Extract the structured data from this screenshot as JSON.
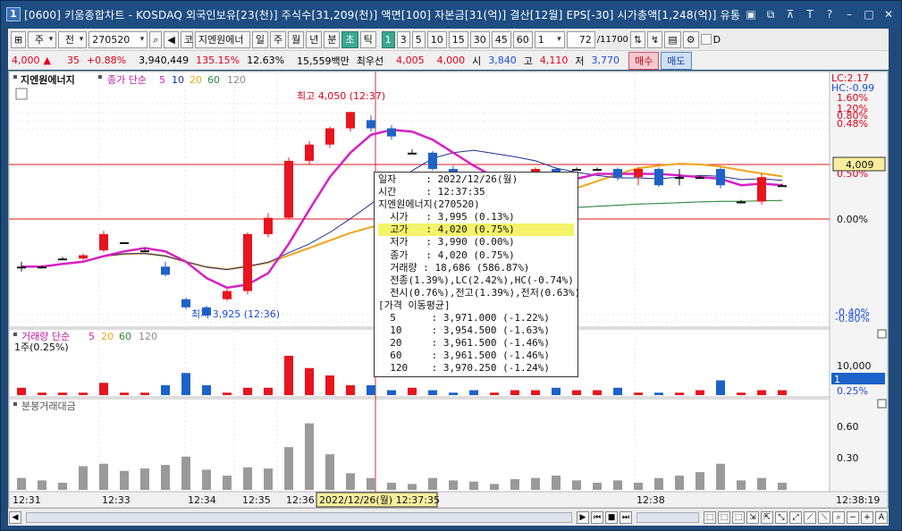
{
  "window": {
    "title": "[0600] 키움종합차트 - KOSDAQ 외국인보유[23(천)] 주식수[31,209(천)] 액면[100] 자본금[31(억)] 결산[12월] EPS[-30] 시가총액[1,248(억)] 유통"
  },
  "toolbar": {
    "period_select": "주",
    "compare_select": "전",
    "code": "270520",
    "stock_name": "지엔원에너",
    "code_prefix": "코",
    "period_buttons": [
      "일",
      "주",
      "월",
      "년",
      "분",
      "초",
      "틱"
    ],
    "interval_buttons": [
      "1",
      "3",
      "5",
      "10",
      "15",
      "30",
      "45",
      "60"
    ],
    "count_value": "1",
    "range_value": "72",
    "range_total": "/11700",
    "d_checkbox_label": "D"
  },
  "quote": {
    "price": "4,000",
    "change_arrow": "▲",
    "change": "35",
    "change_pct": "+0.88%",
    "volume": "3,940,449",
    "volume_ratio": "135.15%",
    "turnover": "12.63%",
    "amount": "15,559백만",
    "best_label": "최우선",
    "ask": "4,005",
    "bid": "4,000",
    "open_label": "시",
    "open": "3,840",
    "high_label": "고",
    "high": "4,110",
    "low_label": "저",
    "low": "3,770",
    "buy_label": "매수",
    "sell_label": "매도"
  },
  "chart": {
    "stock_label": "지엔원에너지",
    "ma_legend": "종가 단순",
    "ma_periods": [
      "5",
      "10",
      "20",
      "60",
      "120"
    ],
    "lc_label": "LC:2.17",
    "hc_label": "HC:-0.99",
    "current_price_tag": "4,009",
    "max_label": "최고 4,050 (12:37)",
    "min_label": "최저 3,925 (12:36)",
    "right_axis": [
      "1.60%",
      "1.20%",
      "0.80%",
      "0.48%",
      "0.50%",
      "0.00%",
      "-0.40%",
      "-0.80%"
    ],
    "volume_legend": "거래량 단순",
    "volume_ma_periods": [
      "5",
      "20",
      "60",
      "120"
    ],
    "volume_unit": "1주(0.25%)",
    "volume_axis": [
      "10,000",
      "1",
      "0.25%"
    ],
    "minute_legend": "분봉거래대금",
    "minute_axis": [
      "0.60",
      "0.30"
    ],
    "time_ticks": [
      "12:31",
      "12:33",
      "12:34",
      "12:35",
      "12:36",
      "12:38"
    ],
    "cursor_time": "2022/12/26(월) 12:37:35",
    "last_time": "12:38:19",
    "colors": {
      "up": "#e8141e",
      "down": "#1c62c8",
      "ma5": "#d620c4",
      "ma10": "#1d2e8f",
      "ma20": "#f0a418",
      "ma60": "#2a8a3a",
      "ma120": "#9a9a9a"
    }
  },
  "tooltip": {
    "rows": [
      "일자     : 2022/12/26(월)",
      "시간     : 12:37:35",
      "지엔원에너지(270520)",
      "  시가   : 3,995 (0.13%)",
      "  고가   : 4,020 (0.75%)",
      "  저가   : 3,990 (0.00%)",
      "  종가   : 4,020 (0.75%)",
      "  거래량 : 18,686 (586.87%)",
      "  전종(1.39%),LC(2.42%),HC(-0.74%)",
      "  전시(0.76%),전고(1.39%),전저(0.63%)",
      "[가격 이동평균]",
      "  5      : 3,971.000 (-1.22%)",
      "  10     : 3,954.500 (-1.63%)",
      "  20     : 3,961.500 (-1.46%)",
      "  60     : 3,961.500 (-1.46%)",
      "  120    : 3,970.250 (-1.24%)"
    ],
    "highlight_index": 4
  },
  "chart_data": {
    "type": "candlestick",
    "candles": [
      {
        "o": 3955,
        "c": 3955,
        "h": 3958,
        "l": 3952
      },
      {
        "o": 3955,
        "c": 3955,
        "h": 3956,
        "l": 3954
      },
      {
        "o": 3960,
        "c": 3960,
        "h": 3961,
        "l": 3959
      },
      {
        "o": 3960,
        "c": 3962,
        "h": 3963,
        "l": 3959
      },
      {
        "o": 3965,
        "c": 3975,
        "h": 3977,
        "l": 3964
      },
      {
        "o": 3970,
        "c": 3970,
        "h": 3970,
        "l": 3970
      },
      {
        "o": 3965,
        "c": 3965,
        "h": 3966,
        "l": 3964
      },
      {
        "o": 3955,
        "c": 3950,
        "h": 3958,
        "l": 3949
      },
      {
        "o": 3935,
        "c": 3930,
        "h": 3936,
        "l": 3929
      },
      {
        "o": 3930,
        "c": 3925,
        "h": 3931,
        "l": 3925
      },
      {
        "o": 3935,
        "c": 3940,
        "h": 3941,
        "l": 3934
      },
      {
        "o": 3940,
        "c": 3975,
        "h": 3976,
        "l": 3938
      },
      {
        "o": 3975,
        "c": 3985,
        "h": 3988,
        "l": 3973
      },
      {
        "o": 3985,
        "c": 4020,
        "h": 4022,
        "l": 3984
      },
      {
        "o": 4020,
        "c": 4030,
        "h": 4032,
        "l": 4018
      },
      {
        "o": 4030,
        "c": 4040,
        "h": 4041,
        "l": 4028
      },
      {
        "o": 4040,
        "c": 4050,
        "h": 4050,
        "l": 4038
      },
      {
        "o": 4045,
        "c": 4040,
        "h": 4048,
        "l": 4038
      },
      {
        "o": 4040,
        "c": 4035,
        "h": 4042,
        "l": 4033
      },
      {
        "o": 4025,
        "c": 4025,
        "h": 4027,
        "l": 4024
      },
      {
        "o": 4025,
        "c": 4015,
        "h": 4026,
        "l": 4014
      },
      {
        "o": 4015,
        "c": 4010,
        "h": 4017,
        "l": 4009
      },
      {
        "o": 4005,
        "c": 4000,
        "h": 4010,
        "l": 3998
      },
      {
        "o": 4000,
        "c": 4000,
        "h": 4002,
        "l": 3998
      },
      {
        "o": 4005,
        "c": 4010,
        "h": 4012,
        "l": 4003
      },
      {
        "o": 4010,
        "c": 4015,
        "h": 4016,
        "l": 4008
      },
      {
        "o": 4015,
        "c": 4005,
        "h": 4016,
        "l": 4003
      },
      {
        "o": 4015,
        "c": 4015,
        "h": 4016,
        "l": 4014
      },
      {
        "o": 4015,
        "c": 4015,
        "h": 4016,
        "l": 4014
      },
      {
        "o": 4015,
        "c": 4010,
        "h": 4016,
        "l": 4008
      },
      {
        "o": 4010,
        "c": 4015,
        "h": 4016,
        "l": 4005
      },
      {
        "o": 4015,
        "c": 4005,
        "h": 4016,
        "l": 4004
      },
      {
        "o": 4010,
        "c": 4010,
        "h": 4015,
        "l": 4005
      },
      {
        "o": 4010,
        "c": 4010,
        "h": 4011,
        "l": 4009
      },
      {
        "o": 4015,
        "c": 4005,
        "h": 4016,
        "l": 4003
      },
      {
        "o": 3995,
        "c": 3995,
        "h": 3996,
        "l": 3994
      },
      {
        "o": 3995,
        "c": 4010,
        "h": 4012,
        "l": 3993
      },
      {
        "o": 4005,
        "c": 4005,
        "h": 4006,
        "l": 4004
      }
    ],
    "volume": [
      3,
      1,
      1,
      1,
      5,
      1,
      1,
      4,
      9,
      4,
      1,
      3,
      3,
      16,
      11,
      8,
      4,
      4,
      2,
      3,
      2,
      1,
      2,
      1,
      2,
      2,
      3,
      2,
      2,
      3,
      1,
      1,
      1,
      2,
      6,
      1,
      2,
      2
    ],
    "minute_amount": [
      0.1,
      0.08,
      0.06,
      0.2,
      0.22,
      0.16,
      0.18,
      0.21,
      0.28,
      0.17,
      0.12,
      0.19,
      0.18,
      0.36,
      0.56,
      0.3,
      0.14,
      0.1,
      0.06,
      0.05,
      0.1,
      0.08,
      0.07,
      0.05,
      0.09,
      0.1,
      0.12,
      0.08,
      0.06,
      0.08,
      0.06,
      0.1,
      0.12,
      0.15,
      0.22,
      0.08,
      0.1,
      0.06
    ],
    "y_range": [
      3920,
      4065
    ]
  }
}
